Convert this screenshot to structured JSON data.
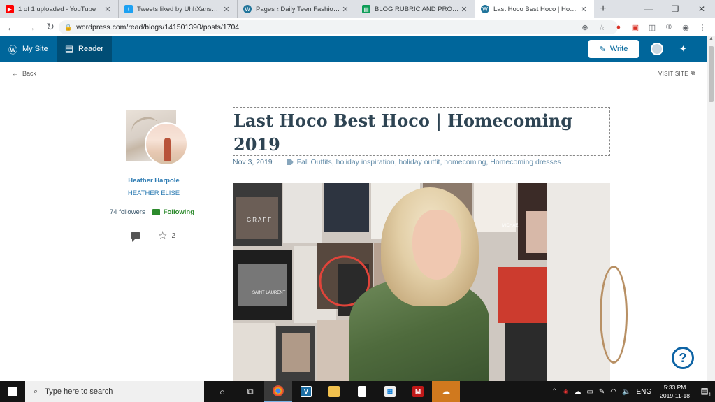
{
  "browser": {
    "tabs": [
      {
        "title": "1 of 1 uploaded - YouTube",
        "favicon_color": "#ff0000",
        "favicon_glyph": "▶"
      },
      {
        "title": "Tweets liked by UhhXans🤯 (@",
        "favicon_color": "#1da1f2",
        "favicon_glyph": "🐦"
      },
      {
        "title": "Pages ‹ Daily Teen Fashion — W",
        "favicon_color": "#21759b",
        "favicon_glyph": "W"
      },
      {
        "title": "BLOG RUBRIC AND PROGRESS",
        "favicon_color": "#0f9d58",
        "favicon_glyph": "▤"
      },
      {
        "title": "Last Hoco Best Hoco | Homeco",
        "favicon_color": "#21759b",
        "favicon_glyph": "W"
      }
    ],
    "new_tab": "+",
    "window_controls": {
      "minimize": "—",
      "maximize": "❐",
      "close": "✕"
    },
    "url": "wordpress.com/read/blogs/141501390/posts/1704"
  },
  "masterbar": {
    "my_site": "My Site",
    "reader": "Reader",
    "write": "Write"
  },
  "reader": {
    "back": "Back",
    "visit_site": "VISIT SITE"
  },
  "author": {
    "name": "Heather Harpole",
    "blog": "HEATHER ELISE",
    "followers": "74 followers",
    "following": "Following",
    "likes": "2"
  },
  "post": {
    "title": "Last Hoco Best Hoco | Homecoming 2019",
    "date": "Nov 3, 2019",
    "tags": "Fall Outfits, holiday inspiration, holiday outfit, homecoming, Homecoming dresses"
  },
  "help": "?",
  "taskbar": {
    "search_placeholder": "Type here to search",
    "lang": "ENG",
    "time": "5:33 PM",
    "date": "2019-11-18",
    "notifications": "1"
  }
}
